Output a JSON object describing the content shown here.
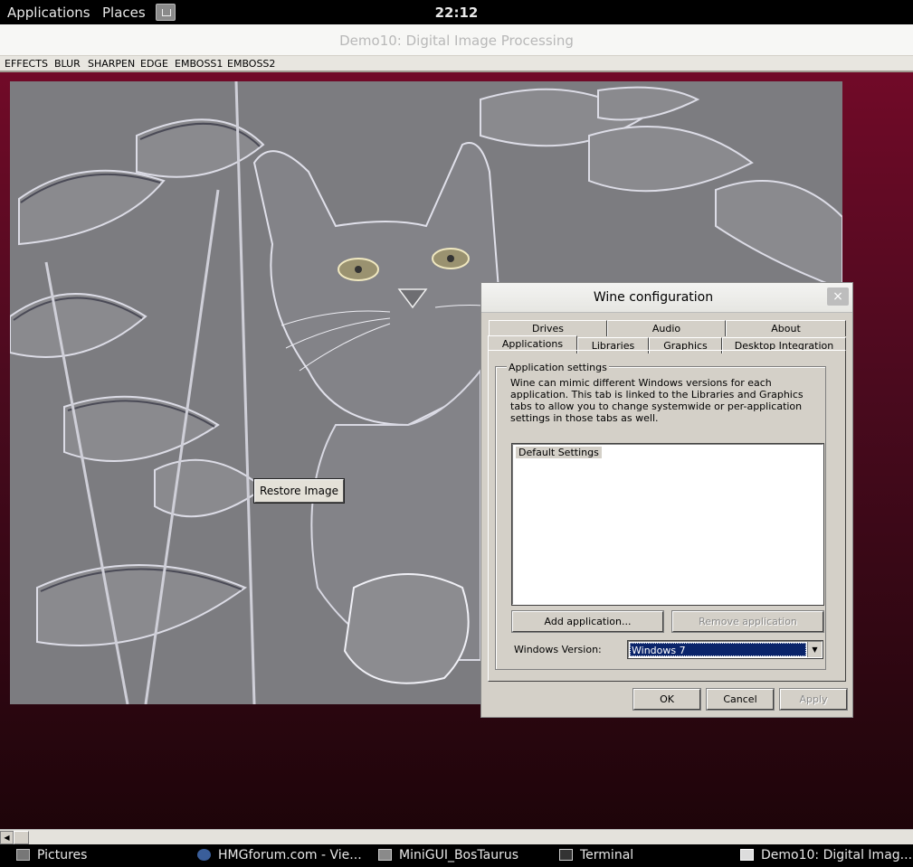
{
  "top_panel": {
    "applications": "Applications",
    "places": "Places",
    "clock": "22:12"
  },
  "app_window": {
    "title": "Demo10: Digital Image Processing",
    "menu": [
      "EFFECTS",
      "BLUR",
      "SHARPEN",
      "EDGE",
      "EMBOSS1",
      "EMBOSS2"
    ],
    "restore_button": "Restore Image"
  },
  "wine_dialog": {
    "title": "Wine configuration",
    "close": "×",
    "tabs_back": [
      "Drives",
      "Audio",
      "About"
    ],
    "tabs_front": [
      "Applications",
      "Libraries",
      "Graphics",
      "Desktop Integration"
    ],
    "group_label": "Application settings",
    "description": "Wine can mimic different Windows versions for each application. This tab is linked to the Libraries and Graphics tabs to allow you to change systemwide or per-application settings in those tabs as well.",
    "list_items": [
      "Default Settings"
    ],
    "add_button": "Add application...",
    "remove_button": "Remove application",
    "version_label": "Windows Version:",
    "version_value": "Windows 7",
    "ok": "OK",
    "cancel": "Cancel",
    "apply": "Apply"
  },
  "taskbar": {
    "items": [
      "Pictures",
      "HMGforum.com - Vie...",
      "MiniGUI_BosTaurus",
      "Terminal",
      "Demo10: Digital Imag..."
    ]
  },
  "colors": {
    "panel": "#000000",
    "dialog_bg": "#d4d0c8",
    "selection": "#0a246a"
  }
}
